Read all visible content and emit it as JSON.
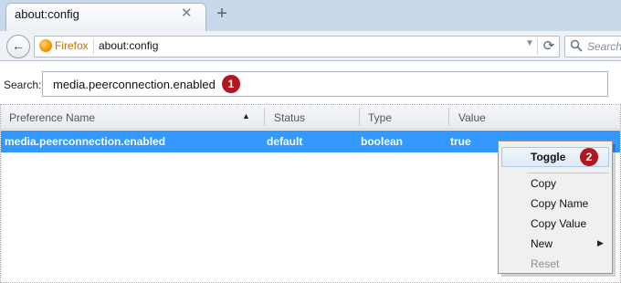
{
  "browser": {
    "tab": {
      "title": "about:config",
      "close_glyph": "✕",
      "new_tab_glyph": "+"
    },
    "nav": {
      "back_glyph": "←",
      "identity_label": "Firefox",
      "url": "about:config",
      "reload_glyph": "⟳",
      "search_placeholder": "Search"
    }
  },
  "page": {
    "search_label": "Search:",
    "search_value": "media.peerconnection.enabled",
    "annotations": {
      "badge1": "1",
      "badge2": "2"
    },
    "table": {
      "headers": {
        "name": "Preference Name",
        "status": "Status",
        "type": "Type",
        "value": "Value"
      },
      "sort_glyph": "▲",
      "selected_row": {
        "name": "media.peerconnection.enabled",
        "status": "default",
        "type": "boolean",
        "value": "true"
      }
    }
  },
  "context_menu": {
    "toggle": "Toggle",
    "copy": "Copy",
    "copy_name": "Copy Name",
    "copy_value": "Copy Value",
    "new": "New",
    "reset": "Reset",
    "submenu_glyph": "▶"
  },
  "colors": {
    "selection": "#3399ff",
    "badge": "#b0171f",
    "tabstrip": "#c9d9ec",
    "identity": "#c37000"
  },
  "icons": [
    "back-arrow-icon",
    "firefox-icon",
    "reload-icon",
    "search-icon",
    "close-icon",
    "new-tab-icon",
    "sort-ascending-icon",
    "submenu-arrow-icon"
  ]
}
